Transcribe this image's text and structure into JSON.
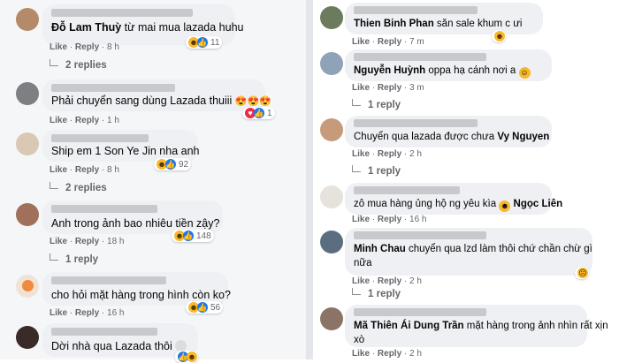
{
  "labels": {
    "like": "Like",
    "reply": "Reply"
  },
  "left": [
    {
      "name": "Đỗ Lam Thuỳ",
      "text": " từ mai mua lazada huhu",
      "time": "8 h",
      "count": "11",
      "replies": "2 replies"
    },
    {
      "text": "Phải chuyển sang dùng Lazada thuiii",
      "emoji": "😍😍😍",
      "time": "1 h",
      "count": "1"
    },
    {
      "text": "Ship em 1 Son Ye Jin nha anh",
      "time": "8 h",
      "count": "92",
      "replies": "2 replies"
    },
    {
      "text": "Anh trong ảnh bao nhiêu tiền zậy?",
      "time": "18 h",
      "count": "148",
      "replies": "1 reply"
    },
    {
      "text": "cho hỏi mặt hàng trong hình còn ko?",
      "time": "16 h",
      "count": "56"
    },
    {
      "text": "Dời nhà qua Lazada thôi"
    }
  ],
  "right": [
    {
      "name": "Thien Binh Phan",
      "text": " săn sale khum c ưi",
      "time": "7 m"
    },
    {
      "name": "Nguyễn Huỳnh",
      "text": " oppa hạ cánh nơi a",
      "time": "3 m",
      "replies": "1 reply"
    },
    {
      "text": "Chuyển qua lazada được chưa ",
      "tag": "Vy Nguyen",
      "time": "2 h",
      "replies": "1 reply"
    },
    {
      "text": "zô mua hàng ủng hộ ng yêu kìa ",
      "tag": "Ngọc Liên",
      "time": "16 h"
    },
    {
      "name": "Minh Chau",
      "text": " chuyển qua lzd làm thôi chứ chần chừ gì",
      "text2": "nữa",
      "time": "2 h",
      "replies": "1 reply"
    },
    {
      "name": "Mã Thiên Ái Dung Trần",
      "text": " mặt hàng trong ảnh nhìn rất xịn",
      "text2": "xò",
      "time": "2 h"
    }
  ]
}
